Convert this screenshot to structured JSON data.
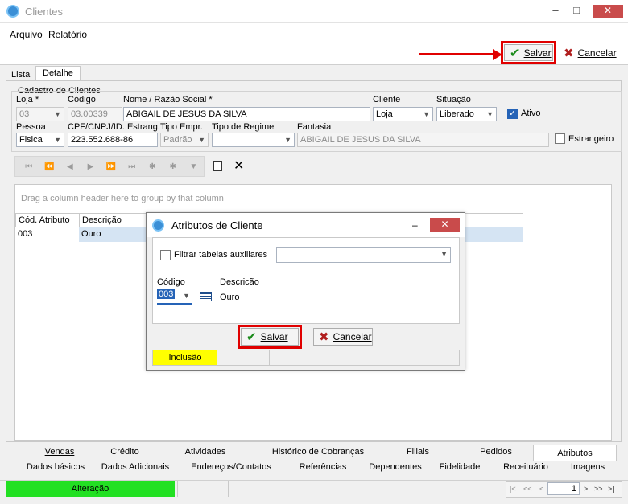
{
  "window": {
    "title": "Clientes",
    "min": "–",
    "max": "□",
    "close": "✕"
  },
  "menu": {
    "arquivo": "Arquivo",
    "relatorio": "Relatório"
  },
  "toolbar": {
    "save": "Salvar",
    "cancel": "Cancelar"
  },
  "tabs": {
    "lista": "Lista",
    "detalhe": "Detalhe"
  },
  "form": {
    "section": "Cadastro de Clientes",
    "loja_label": "Loja *",
    "loja_value": "03",
    "codigo_label": "Código",
    "codigo_value": "03.00339",
    "nome_label": "Nome / Razão Social *",
    "nome_value": "ABIGAIL DE JESUS DA SILVA",
    "cliente_label": "Cliente",
    "cliente_value": "Loja",
    "situacao_label": "Situação",
    "situacao_value": "Liberado",
    "ativo_label": "Ativo",
    "pessoa_label": "Pessoa",
    "pessoa_value": "Fisica",
    "cpf_label": "CPF/CNPJ/ID. Estrang.",
    "cpf_value": "223.552.688-86",
    "tipoempr_label": "Tipo Empr.",
    "tipoempr_value": "Padrão",
    "regime_label": "Tipo de Regime",
    "regime_value": "",
    "fantasia_label": "Fantasia",
    "fantasia_value": "ABIGAIL DE JESUS DA SILVA",
    "estrangeiro_label": "Estrangeiro"
  },
  "nav": {
    "first": "⏮",
    "prevpage": "⏪",
    "prev": "◀",
    "next": "▶",
    "nextpage": "⏩",
    "last": "⏭",
    "add": "✱",
    "edit": "✱",
    "filter": "▼"
  },
  "grid": {
    "group_hint": "Drag a column header here to group by that column",
    "columns": [
      "Cód. Atributo",
      "Descrição"
    ],
    "rows": [
      {
        "codigo": "003",
        "descricao": "Ouro"
      }
    ]
  },
  "dialog": {
    "title": "Atributos de Cliente",
    "filter_label": "Filtrar tabelas auxiliares",
    "codigo_label": "Código",
    "codigo_value": "003",
    "descricao_label": "Descricão",
    "descricao_value": "Ouro",
    "save": "Salvar",
    "cancel": "Cancelar",
    "status": "Inclusão"
  },
  "bottom_tabs_row1": [
    "Vendas",
    "Crédito",
    "Atividades",
    "Histórico de Cobranças",
    "Filiais",
    "Pedidos",
    "Atributos"
  ],
  "bottom_tabs_row2": [
    "Dados básicos",
    "Dados Adicionais",
    "Endereços/Contatos",
    "Referências",
    "Dependentes",
    "Fidelidade",
    "Receituário",
    "Imagens"
  ],
  "status": {
    "mode": "Alteração",
    "page": "1"
  },
  "pager": {
    "first": "|<",
    "prev2": "<<",
    "prev": "<",
    "next": ">",
    "next2": ">>",
    "last": ">|"
  },
  "colors": {
    "accent_red": "#e00000",
    "status_green": "#22e022",
    "status_yellow": "#ffff00",
    "selection": "#d5e4f3"
  }
}
